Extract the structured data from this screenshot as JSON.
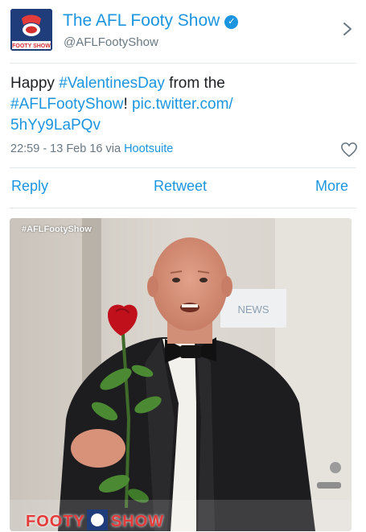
{
  "account": {
    "name": "The AFL Footy Show",
    "handle": "@AFLFootyShow",
    "avatar_text": "FOOTY SHOW",
    "verified_icon": "verified-badge-icon"
  },
  "tweet": {
    "text_1": "Happy ",
    "hashtag_1": "#ValentinesDay",
    "text_2": " from the",
    "hashtag_2": "#AFLFootyShow",
    "text_3": "! ",
    "link_1": "pic.twitter.com/",
    "link_2": "5hYy9LaPQv"
  },
  "meta": {
    "time": "22:59 - 13 Feb 16 via ",
    "source": "Hootsuite"
  },
  "actions": {
    "reply": "Reply",
    "retweet": "Retweet",
    "more": "More"
  },
  "photo": {
    "tag": "#AFLFootyShow",
    "screen_text": "NEWS",
    "brand_left": "FOOTY",
    "brand_right": "SHOW"
  },
  "colors": {
    "link": "#1b95e0",
    "text": "#1c2022",
    "secondary": "#697882",
    "divider": "#e1e8ed",
    "rose": "#c0101c"
  }
}
